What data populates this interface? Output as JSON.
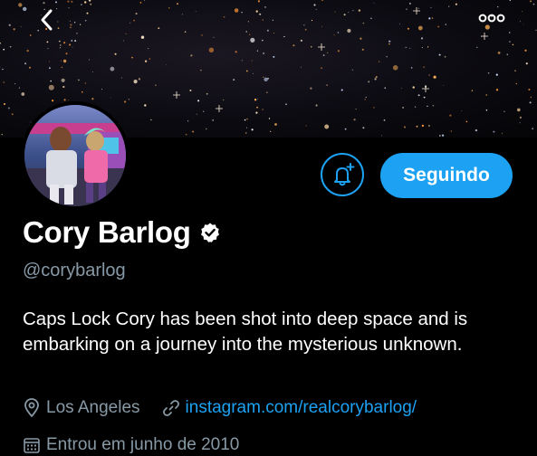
{
  "profile": {
    "display_name": "Cory Barlog",
    "handle": "@corybarlog",
    "bio": "Caps Lock Cory has been shot into deep space and is embarking on a journey into the mysterious unknown.",
    "location": "Los Angeles",
    "website": "instagram.com/realcorybarlog/",
    "joined": "Entrou em junho de 2010",
    "verified": true
  },
  "actions": {
    "follow_label": "Seguindo"
  },
  "colors": {
    "accent": "#1da1f2",
    "secondary_text": "#8899a6",
    "background": "#000000"
  },
  "icons": {
    "back": "chevron-left-icon",
    "more": "more-options-icon",
    "bell": "bell-plus-icon",
    "verified": "verified-badge-icon",
    "location": "location-pin-icon",
    "link": "link-icon",
    "calendar": "calendar-icon"
  }
}
